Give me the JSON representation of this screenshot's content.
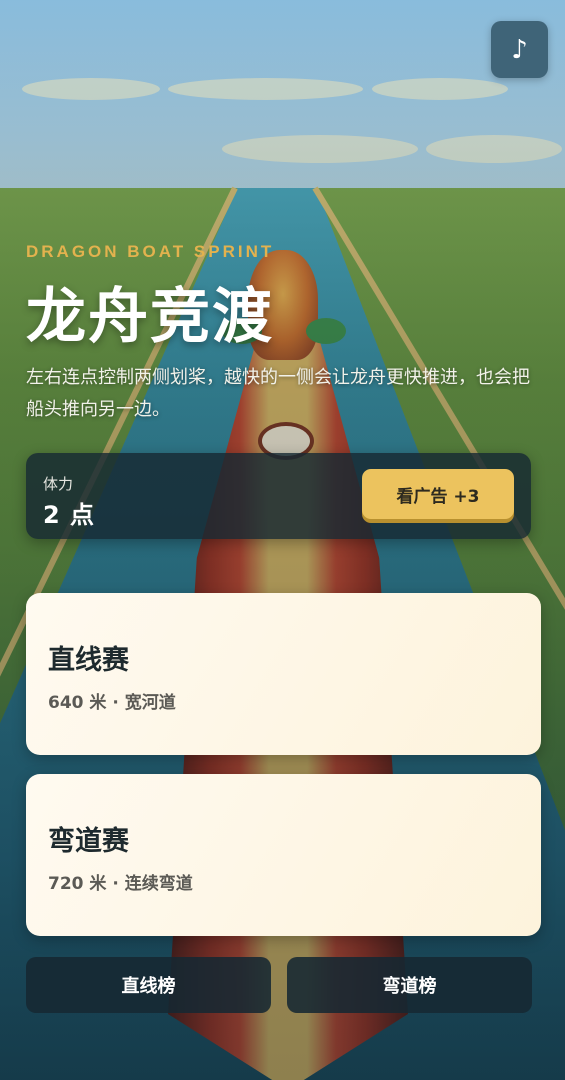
{
  "header": {
    "music_icon": "music-note-icon",
    "music_glyph": "♪"
  },
  "hero": {
    "subtitle": "DRAGON BOAT SPRINT",
    "title": "龙舟竞渡",
    "description": "左右连点控制两侧划桨，越快的一侧会让龙舟更快推进，也会把船头推向另一边。"
  },
  "stamina": {
    "label": "体力",
    "value": "2 点",
    "ad_button": "看广告 +3"
  },
  "races": [
    {
      "name": "直线赛",
      "info": "640 米 · 宽河道"
    },
    {
      "name": "弯道赛",
      "info": "720 米 · 连续弯道"
    }
  ],
  "leaderboards": {
    "straight": "直线榜",
    "curve": "弯道榜"
  },
  "colors": {
    "accent_gold": "#ecc35e",
    "subtitle_gold": "#e3b24e",
    "panel_dark": "#162832",
    "card_cream": "#fffaf0"
  }
}
